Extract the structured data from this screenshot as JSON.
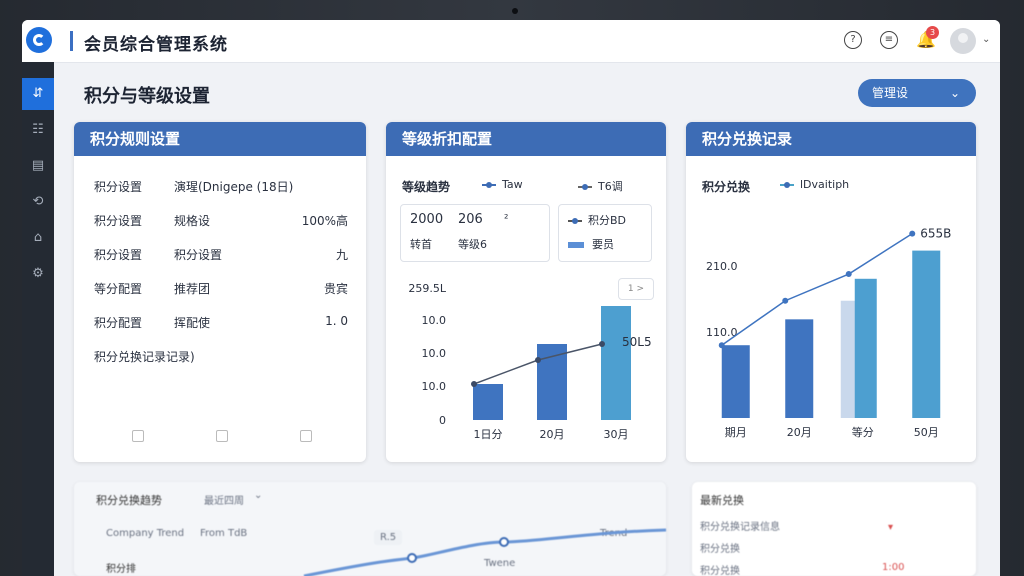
{
  "app": {
    "title": "会员综合管理系统",
    "notification_count": "3"
  },
  "sidebar": {
    "items": [
      "⇵",
      "☷",
      "▤",
      "⟲",
      "⌂",
      "⚙"
    ]
  },
  "page": {
    "title": "积分与等级设置",
    "manage_button": "管理设"
  },
  "card1": {
    "header": "积分规则设置",
    "rows": [
      {
        "a": "积分设置",
        "b": "演瑆(Dnigepe (18⽇)",
        "c": ""
      },
      {
        "a": "积分设置",
        "b": "规格设",
        "c": "100%高"
      },
      {
        "a": "积分设置",
        "b": "积分设置",
        "c": "九"
      },
      {
        "a": "等分配置",
        "b": "推荐团",
        "c": "贵宾"
      },
      {
        "a": "积分配置",
        "b": "挥配使",
        "c": "1. 0"
      }
    ],
    "footer": "积分兑换记录记录)"
  },
  "card2": {
    "header": "等级折扣配置",
    "trend_title": "等级趋势",
    "legend": [
      "Taw",
      "T6调"
    ],
    "box1": {
      "l1a": "2000",
      "l1b": "206",
      "l1c": "²",
      "l2a": "转首",
      "l2b": "等级6"
    },
    "box2": {
      "l1": "积分BD",
      "l2": "要员"
    },
    "pager": "1 >"
  },
  "card3": {
    "header": "积分兑换记录",
    "title": "积分兑换",
    "legend": "lDvaitiph"
  },
  "chart_data": [
    {
      "type": "bar",
      "categories": [
        "1日分",
        "20月",
        "30月"
      ],
      "values": [
        0.9,
        1.9,
        2.85
      ],
      "line_values": [
        0.6,
        1.2,
        1.6
      ],
      "peak_label": "50L5",
      "y_ticks": [
        "0",
        "10.0",
        "10.0",
        "10.0",
        "259.5L"
      ]
    },
    {
      "type": "bar",
      "categories": [
        "期月",
        "20月",
        "等分",
        "50月"
      ],
      "values": [
        90,
        122,
        140,
        207
      ],
      "pale_values": [
        145,
        0,
        0,
        0
      ],
      "line_values": [
        90,
        145,
        178,
        228
      ],
      "peak_label": "655B",
      "y_ticks": [
        "110.0",
        "210.0"
      ]
    }
  ],
  "bottom": {
    "left_title": "积分兑换趋势",
    "left_select": "最近四周",
    "left_legend_a": "Company Trend",
    "left_legend_b": "From TdB",
    "left_tag": "R.5",
    "left_trend_a": "Trend",
    "left_trend_b": "Twene",
    "left_axis": "积分排",
    "right_title": "最新兑换",
    "right_row1": "积分兑换记录信息",
    "right_row2": "积分兑换",
    "right_row3": "积分兑换",
    "right_mark": "1:00"
  }
}
